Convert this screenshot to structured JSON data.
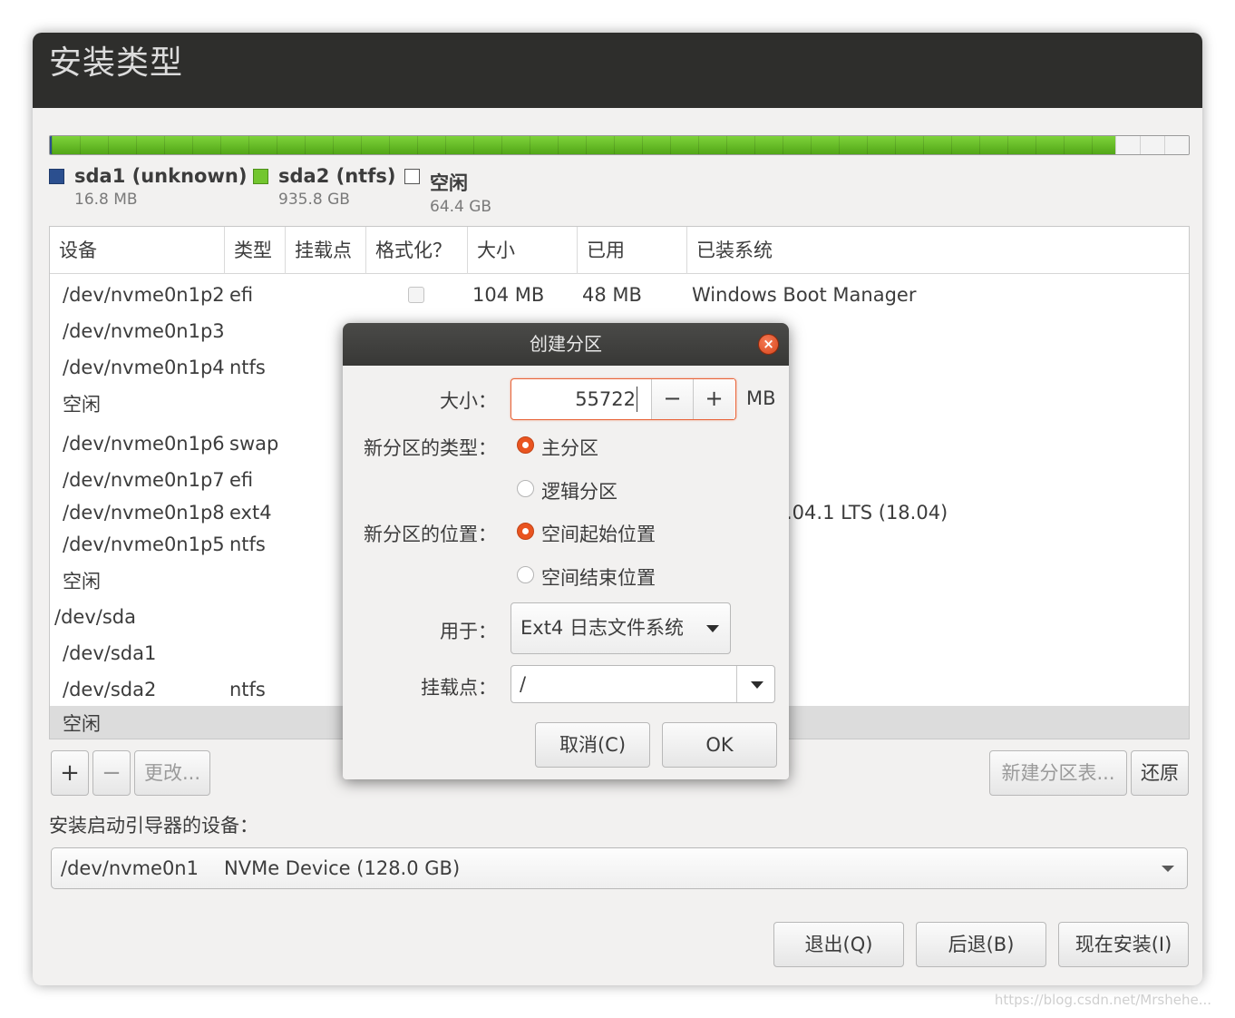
{
  "window": {
    "title": "安装类型"
  },
  "legend": [
    {
      "name": "sda1 (unknown)",
      "size": "16.8 MB",
      "color": "#2b4f8f"
    },
    {
      "name": "sda2 (ntfs)",
      "size": "935.8 GB",
      "color": "#73c62f"
    },
    {
      "name": "空闲",
      "size": "64.4 GB",
      "color": "#ffffff"
    }
  ],
  "usage_fractions": {
    "sda1": 2e-05,
    "sda2": 0.9356,
    "free": 0.0644
  },
  "table": {
    "headers": [
      "设备",
      "类型",
      "挂载点",
      "格式化？",
      "大小",
      "已用",
      "已装系统"
    ],
    "rows": [
      {
        "device": "/dev/nvme0n1p2",
        "type": "efi",
        "format_checked": false,
        "size": "104 MB",
        "used": "48 MB",
        "system": "Windows Boot Manager"
      },
      {
        "device": "/dev/nvme0n1p3",
        "type": "",
        "size": "",
        "used": "",
        "system": ""
      },
      {
        "device": "/dev/nvme0n1p4",
        "type": "ntfs",
        "size": "",
        "used": "",
        "system": ""
      },
      {
        "device": "空闲",
        "type": "",
        "size": "",
        "used": "",
        "system": ""
      },
      {
        "device": "/dev/nvme0n1p6",
        "type": "swap",
        "size": "",
        "used": "",
        "system": ""
      },
      {
        "device": "/dev/nvme0n1p7",
        "type": "efi",
        "size": "",
        "used": "",
        "system": ""
      },
      {
        "device": "/dev/nvme0n1p8",
        "type": "ext4",
        "size": "",
        "used": "",
        "system": ".04.1 LTS (18.04)"
      },
      {
        "device": "/dev/nvme0n1p5",
        "type": "ntfs",
        "size": "",
        "used": "",
        "system": ""
      },
      {
        "device": "空闲",
        "type": "",
        "size": "",
        "used": "",
        "system": ""
      },
      {
        "device": "/dev/sda",
        "type": "",
        "size": "",
        "used": "",
        "system": ""
      },
      {
        "device": "/dev/sda1",
        "type": "",
        "size": "",
        "used": "",
        "system": ""
      },
      {
        "device": "/dev/sda2",
        "type": "ntfs",
        "size": "",
        "used": "",
        "system": ""
      },
      {
        "device": "空闲",
        "type": "",
        "size": "",
        "used": "",
        "system": ""
      }
    ]
  },
  "toolbar": {
    "add": "+",
    "remove": "−",
    "change": "更改...",
    "new_table": "新建分区表...",
    "revert": "还原"
  },
  "boot": {
    "label": "安装启动引导器的设备：",
    "device": "/dev/nvme0n1",
    "description": "NVMe Device (128.0 GB)"
  },
  "footer": {
    "quit": "退出(Q)",
    "back": "后退(B)",
    "install": "现在安装(I)"
  },
  "dialog": {
    "title": "创建分区",
    "close": "×",
    "size_label": "大小：",
    "size_value": "55722",
    "size_unit": "MB",
    "minus": "−",
    "plus": "+",
    "type_label": "新分区的类型：",
    "type_primary": "主分区",
    "type_logical": "逻辑分区",
    "location_label": "新分区的位置：",
    "location_start": "空间起始位置",
    "location_end": "空间结束位置",
    "use_label": "用于：",
    "use_value": "Ext4 日志文件系统",
    "mount_label": "挂载点：",
    "mount_value": "/",
    "cancel": "取消(C)",
    "ok": "OK"
  },
  "watermark": "https://blog.csdn.net/Mrshehe..."
}
